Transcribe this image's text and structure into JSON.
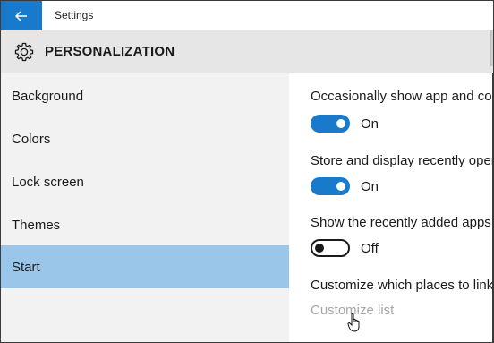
{
  "window": {
    "title": "Settings"
  },
  "header": {
    "title": "PERSONALIZATION",
    "icon": "gear-icon"
  },
  "sidebar": {
    "items": [
      {
        "label": "Background",
        "selected": false
      },
      {
        "label": "Colors",
        "selected": false
      },
      {
        "label": "Lock screen",
        "selected": false
      },
      {
        "label": "Themes",
        "selected": false
      },
      {
        "label": "Start",
        "selected": true
      }
    ]
  },
  "content": {
    "settings": [
      {
        "label": "Occasionally show app and con",
        "state": "On",
        "on": true
      },
      {
        "label": "Store and display recently oper",
        "state": "On",
        "on": true
      },
      {
        "label": "Show the recently added apps",
        "state": "Off",
        "on": false
      }
    ],
    "places_label": "Customize which places to link",
    "customize_link": "Customize list"
  },
  "colors": {
    "accent": "#1979ca",
    "selected_nav": "#99c6e9",
    "sidebar_bg": "#f2f2f2",
    "header_bg": "#e6e6e6",
    "link_disabled": "#a6a6a6"
  }
}
